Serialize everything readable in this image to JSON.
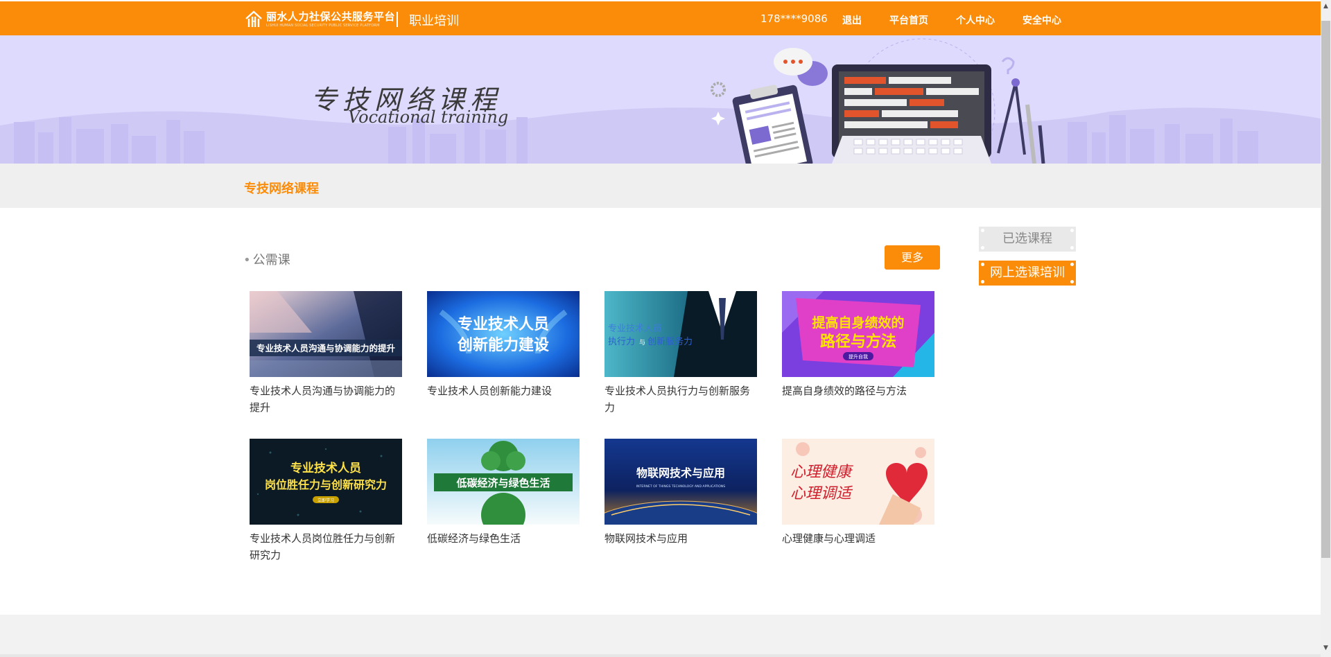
{
  "header": {
    "logo_cn": "丽水人力社保公共服务平台",
    "logo_en": "LISHUI HUMAN SOCIAL SECURITY PUBLIC SERVICE PLATFORM",
    "section": "职业培训",
    "phone": "178****9086",
    "nav": {
      "logout": "退出",
      "home": "平台首页",
      "personal": "个人中心",
      "security": "安全中心"
    }
  },
  "banner": {
    "title": "专技网络课程",
    "subtitle": "Vocational training"
  },
  "breadcrumb": "专技网络课程",
  "category": {
    "title": "公需课",
    "more_label": "更多"
  },
  "courses": [
    {
      "name": "专业技术人员沟通与协调能力的提升",
      "thumb_text": "专业技术人员沟通与协调能力的提升"
    },
    {
      "name": "专业技术人员创新能力建设",
      "thumb_text_1": "专业技术人员",
      "thumb_text_2": "创新能力建设"
    },
    {
      "name": "专业技术人员执行力与创新服务力",
      "thumb_text_1": "专业技术人员",
      "thumb_text_2": "执行力",
      "thumb_text_3": "与",
      "thumb_text_4": "创新服务力"
    },
    {
      "name": "提高自身绩效的路径与方法",
      "thumb_text_1": "提高自身绩效的",
      "thumb_text_2": "路径与方法",
      "thumb_text_3": "提升自我"
    },
    {
      "name": "专业技术人员岗位胜任力与创新研究力",
      "thumb_text_1": "专业技术人员",
      "thumb_text_2": "岗位胜任力与创新研究力",
      "thumb_text_3": "立即学习"
    },
    {
      "name": "低碳经济与绿色生活",
      "thumb_text": "低碳经济与绿色生活"
    },
    {
      "name": "物联网技术与应用",
      "thumb_text_1": "物联网技术与应用",
      "thumb_text_2": "INTERNET OF THINGS TECHNOLOGY AND APPLICATIONS"
    },
    {
      "name": "心理健康与心理调适",
      "thumb_text_1": "心理健康",
      "thumb_text_2": "心理调适"
    }
  ],
  "side": {
    "selected_label": "已选课程",
    "online_label": "网上选课培训"
  },
  "colors": {
    "accent": "#fb8c0a",
    "banner_bg": "#dedafd",
    "band_bg": "#efefef"
  }
}
